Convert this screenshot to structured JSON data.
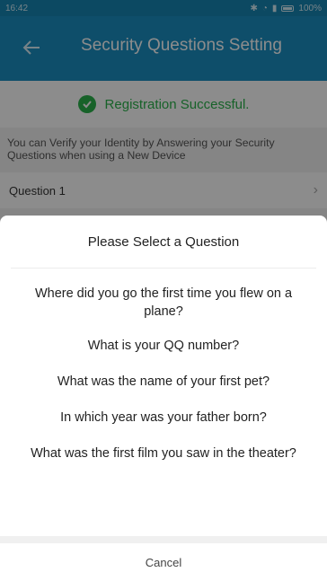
{
  "status_bar": {
    "time": "16:42",
    "battery": "100%"
  },
  "header": {
    "title": "Security Questions Setting"
  },
  "success": {
    "message": "Registration Successful."
  },
  "info": {
    "text": "You can Verify your Identity by Answering your Security Questions when using a New Device"
  },
  "question_row": {
    "label": "Question 1"
  },
  "sheet": {
    "title": "Please Select a Question",
    "options": [
      "Where did you go the first time you flew on a plane?",
      "What is your QQ number?",
      "What was the name of your first pet?",
      "In which year was your father born?",
      "What was the first film you saw in the theater?"
    ],
    "cancel_label": "Cancel"
  },
  "colors": {
    "header": "#1a8fc2",
    "success": "#2bb24c"
  }
}
